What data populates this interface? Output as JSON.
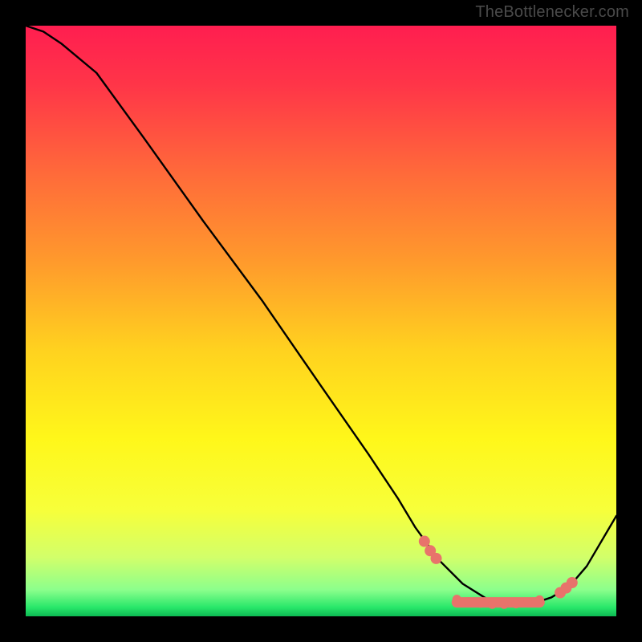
{
  "attribution": "TheBottlenecker.com",
  "colors": {
    "marker": "#e8736b",
    "curve": "#000000"
  },
  "chart_data": {
    "type": "line",
    "title": "",
    "xlabel": "",
    "ylabel": "",
    "xlim": [
      0,
      100
    ],
    "ylim": [
      0,
      100
    ],
    "x": [
      0,
      3,
      6,
      12,
      20,
      30,
      40,
      50,
      58,
      63,
      66,
      70,
      74,
      78,
      82,
      86,
      89,
      92,
      95,
      100
    ],
    "values": [
      100,
      99,
      97,
      92,
      81,
      67,
      53.5,
      39,
      27.5,
      20,
      15,
      9.5,
      5.5,
      3,
      2,
      2.2,
      3.2,
      5,
      8.5,
      17
    ],
    "series": [
      {
        "name": "bottleneck-curve",
        "x": [
          0,
          3,
          6,
          12,
          20,
          30,
          40,
          50,
          58,
          63,
          66,
          70,
          74,
          78,
          82,
          86,
          89,
          92,
          95,
          100
        ],
        "values": [
          100,
          99,
          97,
          92,
          81,
          67,
          53.5,
          39,
          27.5,
          20,
          15,
          9.5,
          5.5,
          3,
          2,
          2.2,
          3.2,
          5,
          8.5,
          17
        ]
      }
    ],
    "markers": {
      "left": {
        "x": [
          67.5,
          68.5,
          69.5
        ],
        "y": [
          12.7,
          11.1,
          9.8
        ]
      },
      "bottom": {
        "x": [
          73,
          75,
          77,
          79,
          81,
          83,
          85,
          87
        ],
        "y": [
          2.9,
          2.5,
          2.2,
          2.0,
          2.0,
          2.1,
          2.4,
          2.8
        ]
      },
      "right": {
        "x": [
          90.5,
          91.5,
          92.5
        ],
        "y": [
          4.0,
          4.8,
          5.7
        ]
      }
    }
  }
}
